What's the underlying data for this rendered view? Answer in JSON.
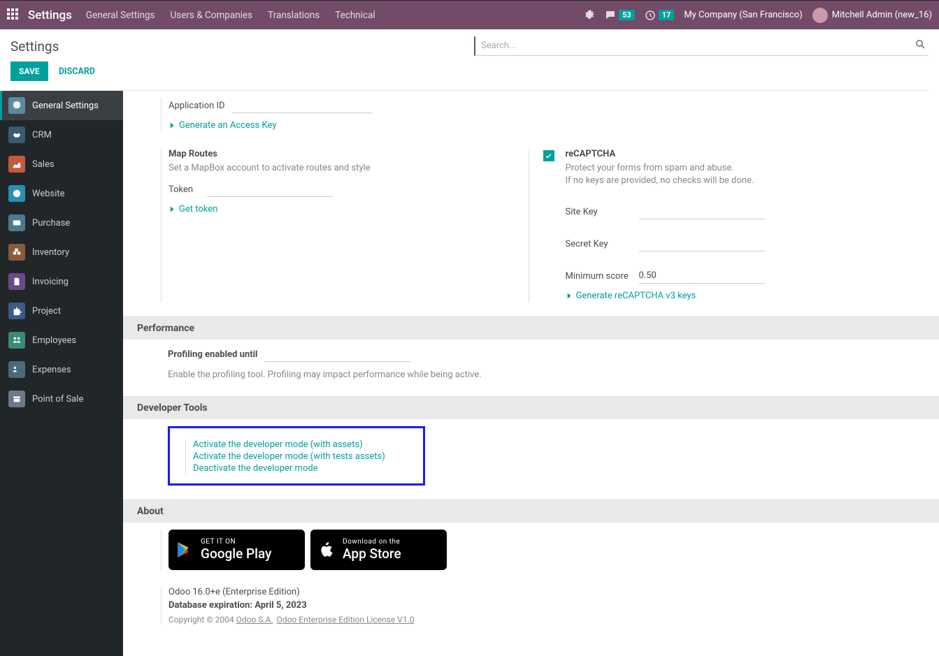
{
  "navbar": {
    "brand": "Settings",
    "menu": [
      "General Settings",
      "Users & Companies",
      "Translations",
      "Technical"
    ],
    "discuss_badge": "53",
    "activity_badge": "17",
    "company": "My Company (San Francisco)",
    "user": "Mitchell Admin (new_16)"
  },
  "actionbar": {
    "title": "Settings",
    "save": "SAVE",
    "discard": "DISCARD",
    "search_placeholder": "Search..."
  },
  "sidebar": {
    "items": [
      {
        "label": "General Settings"
      },
      {
        "label": "CRM"
      },
      {
        "label": "Sales"
      },
      {
        "label": "Website"
      },
      {
        "label": "Purchase"
      },
      {
        "label": "Inventory"
      },
      {
        "label": "Invoicing"
      },
      {
        "label": "Project"
      },
      {
        "label": "Employees"
      },
      {
        "label": "Expenses"
      },
      {
        "label": "Point of Sale"
      }
    ]
  },
  "integrations": {
    "application_id_label": "Application ID",
    "generate_access_key": "Generate an Access Key",
    "map_routes": {
      "title": "Map Routes",
      "desc": "Set a MapBox account to activate routes and style",
      "token_label": "Token",
      "get_token": "Get token"
    },
    "recaptcha": {
      "title": "reCAPTCHA",
      "desc1": "Protect your forms from spam and abuse.",
      "desc2": "If no keys are provided, no checks will be done.",
      "site_key_label": "Site Key",
      "secret_key_label": "Secret Key",
      "min_score_label": "Minimum score",
      "min_score_value": "0.50",
      "generate_link": "Generate reCAPTCHA v3 keys"
    }
  },
  "performance": {
    "header": "Performance",
    "profiling_label": "Profiling enabled until",
    "profiling_desc": "Enable the profiling tool. Profiling may impact performance while being active."
  },
  "developer": {
    "header": "Developer Tools",
    "activate_assets": "Activate the developer mode (with assets)",
    "activate_tests": "Activate the developer mode (with tests assets)",
    "deactivate": "Deactivate the developer mode"
  },
  "about": {
    "header": "About",
    "google_small": "GET IT ON",
    "google_big": "Google Play",
    "apple_small": "Download on the",
    "apple_big": "App Store",
    "version": "Odoo 16.0+e (Enterprise Edition)",
    "expiration": "Database expiration: April 5, 2023",
    "copyright_prefix": "Copyright © 2004 ",
    "odoo_sa": "Odoo S.A.",
    "license": "Odoo Enterprise Edition License V1.0"
  }
}
